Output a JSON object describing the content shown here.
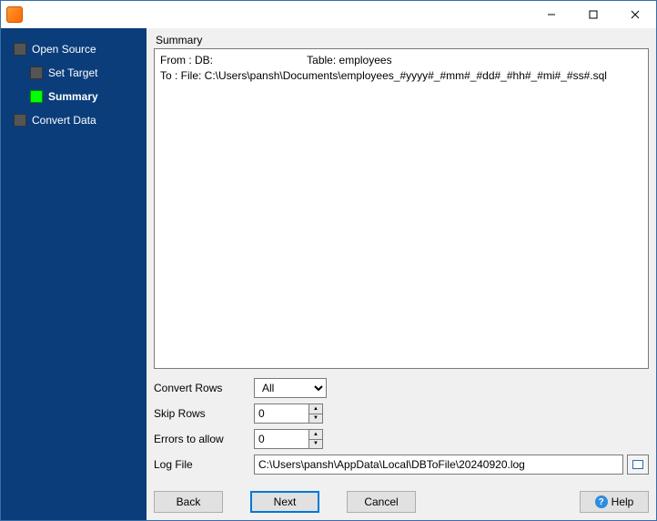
{
  "sidebar": {
    "items": [
      {
        "label": "Open Source",
        "active": false
      },
      {
        "label": "Set Target",
        "active": false
      },
      {
        "label": "Summary",
        "active": true
      },
      {
        "label": "Convert Data",
        "active": false
      }
    ]
  },
  "main": {
    "section_title": "Summary",
    "summary_lines": {
      "from_prefix": "From : DB:",
      "from_table_label": "Table:",
      "from_table": "employees",
      "to": "To : File: C:\\Users\\pansh\\Documents\\employees_#yyyy#_#mm#_#dd#_#hh#_#mi#_#ss#.sql"
    },
    "options": {
      "convert_rows_label": "Convert Rows",
      "convert_rows_value": "All",
      "skip_rows_label": "Skip Rows",
      "skip_rows_value": "0",
      "errors_label": "Errors to allow",
      "errors_value": "0",
      "logfile_label": "Log File",
      "logfile_value": "C:\\Users\\pansh\\AppData\\Local\\DBToFile\\20240920.log"
    }
  },
  "buttons": {
    "back": "Back",
    "next": "Next",
    "cancel": "Cancel",
    "help": "Help"
  }
}
